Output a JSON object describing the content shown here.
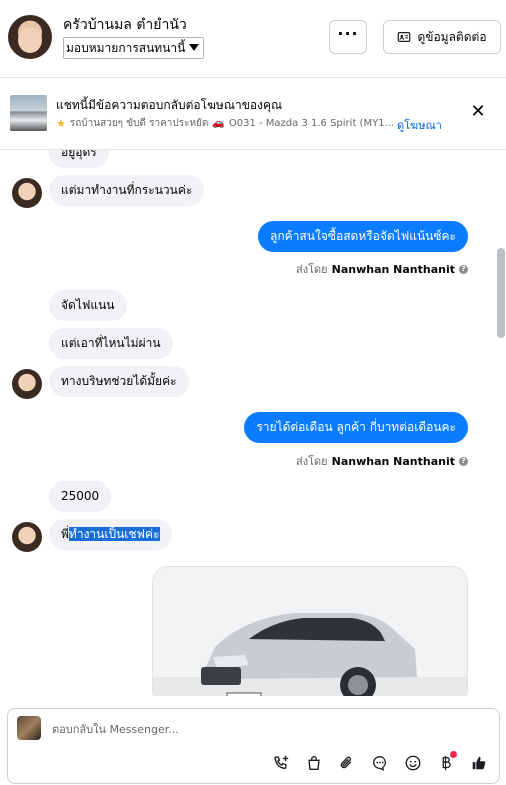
{
  "header": {
    "contact_name": "ครัวบ้านมล ตำยำนัว",
    "assign_label": "มอบหมายการสนทนานี้",
    "more_label": "···",
    "contact_info_label": "ดูข้อมูลติดต่อ"
  },
  "ad": {
    "title": "แชทนี้มีข้อความตอบกลับต่อโฆษณาของคุณ",
    "subtitle": "รถบ้านสวยๆ ขับดี ราคาประหยัด",
    "ad_ref": "O031 - Mazda 3 1.6 Spirit (MY1...",
    "view_ad_label": "ดูโฆษณา",
    "close_label": "✕"
  },
  "messages": {
    "m1": "อยู่อุดร",
    "m2": "แต่มาทำงานที่กระนวนค่ะ",
    "m3": "ลูกค้าสนใจซื้อสดหรือจัดไฟแน้นซ์คะ",
    "m4": "จัดไฟแนน",
    "m5": "แต่เอาที่ไหนไม่ผ่าน",
    "m6": "ทางบริษทช่วยได้มั้ยค่ะ",
    "m7": "รายได้ต่อเดือน ลูกค้า กี่บาทต่อเดือนคะ",
    "m8": "25000",
    "m9_prefix": "พี่",
    "m9_selected": "ทำงานเป็นเชฟค่ะ"
  },
  "sent_by": {
    "prefix": "ส่งโดย",
    "name": "Nanwhan Nanthanit"
  },
  "composer": {
    "placeholder": "ตอบกลับใน Messenger..."
  },
  "icons": {
    "call": "phone-add-icon",
    "shop": "shopping-bag-icon",
    "attach": "paperclip-icon",
    "chat": "chat-bubble-icon",
    "emoji": "emoji-icon",
    "baht": "baht-icon",
    "like": "thumbs-up-icon"
  },
  "colors": {
    "outgoing_bubble": "#0a7cff",
    "incoming_bubble": "#f0f2f5",
    "link": "#0064d1",
    "notification_dot": "#f02849"
  }
}
